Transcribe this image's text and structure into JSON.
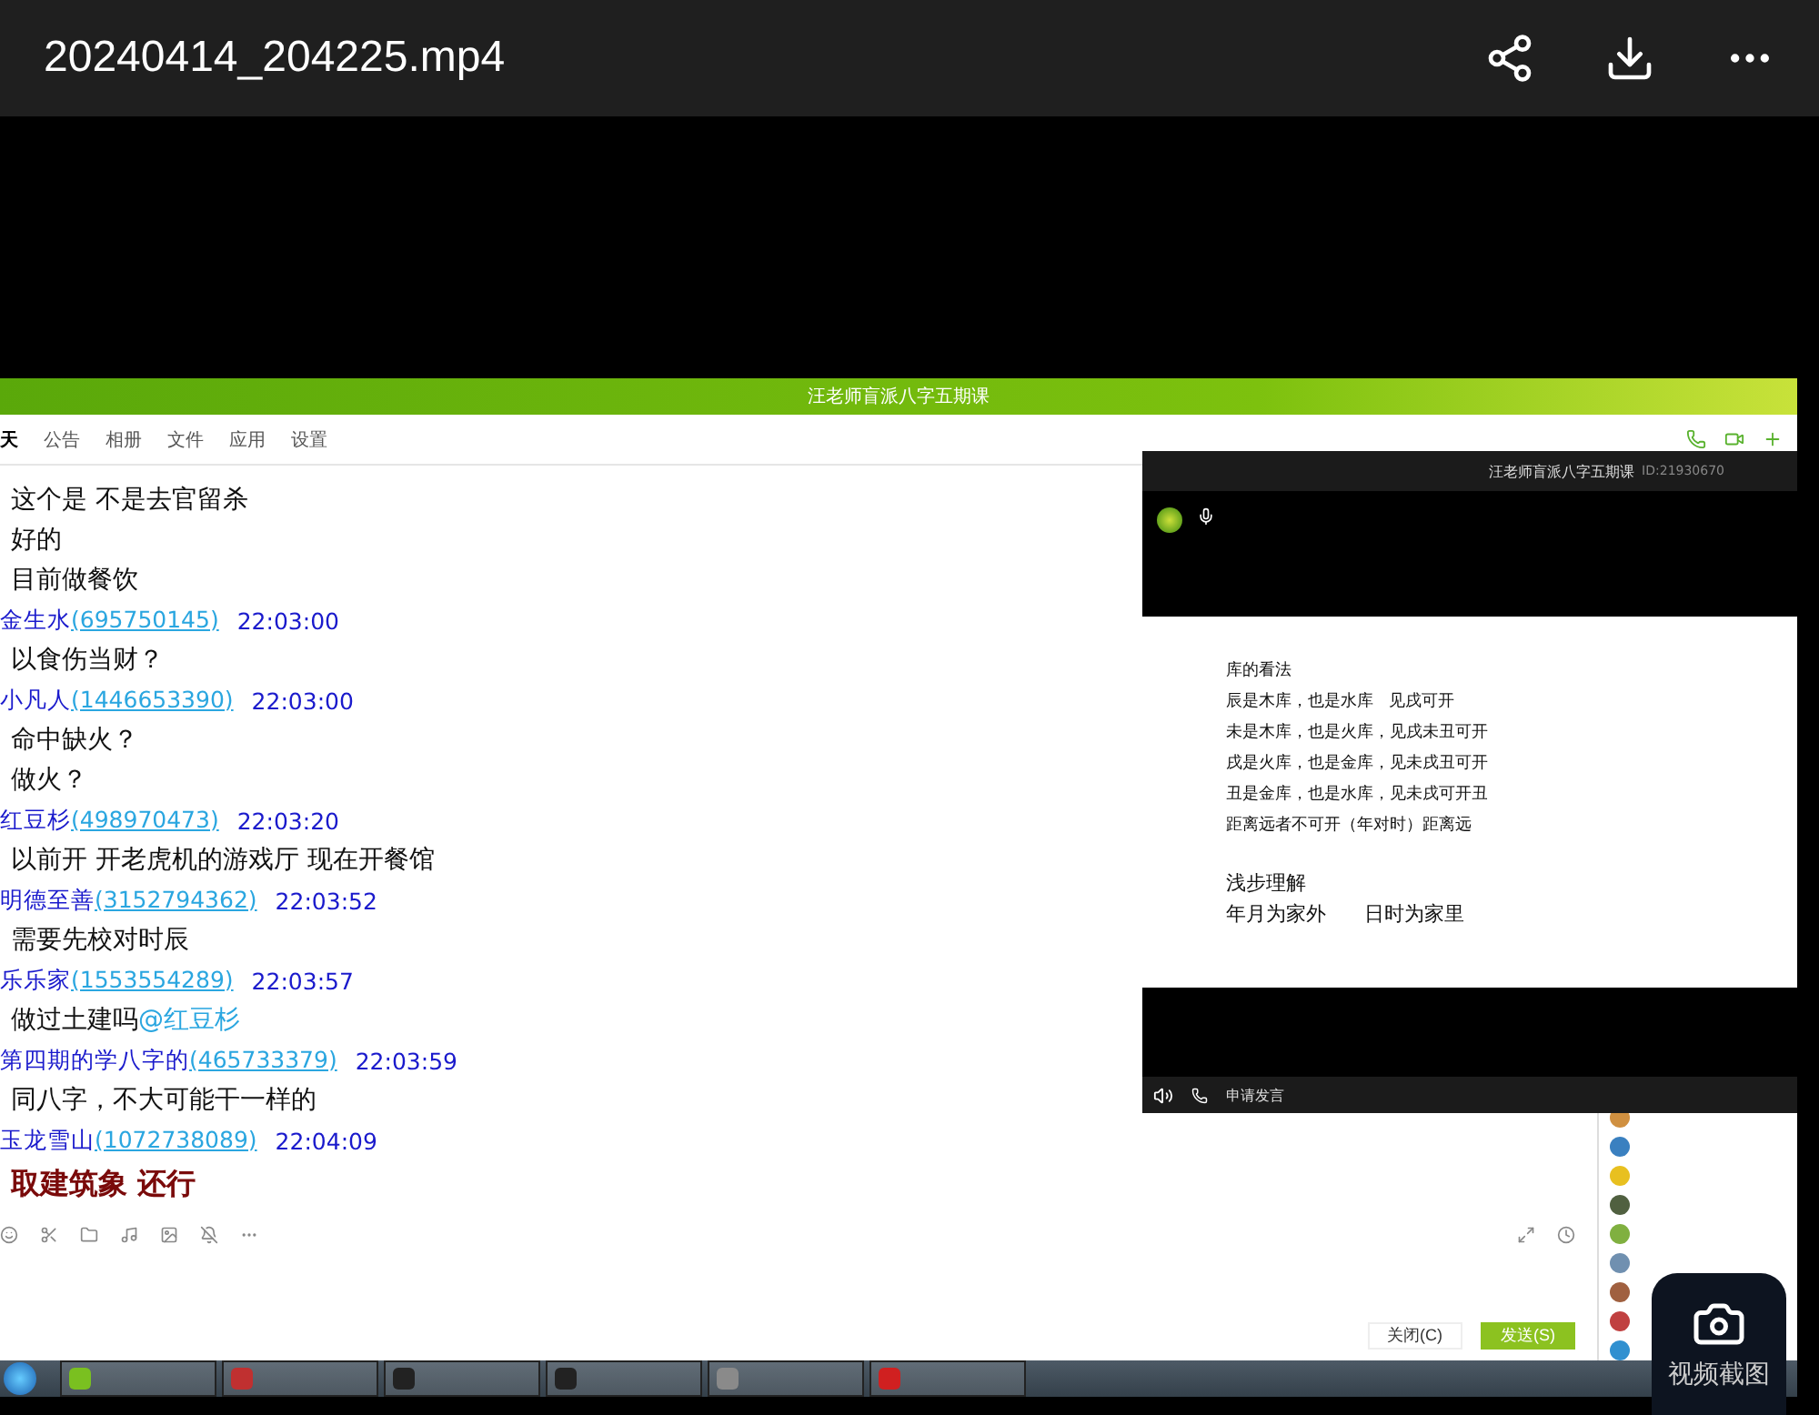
{
  "player": {
    "title": "20240414_204225.mp4",
    "screenshot_label": "视频截图"
  },
  "qq": {
    "title": "汪老师盲派八字五期课",
    "tabs": [
      {
        "label": "天",
        "selected": true
      },
      {
        "label": "公告",
        "selected": false
      },
      {
        "label": "相册",
        "selected": false
      },
      {
        "label": "文件",
        "selected": false
      },
      {
        "label": "应用",
        "selected": false
      },
      {
        "label": "设置",
        "selected": false
      }
    ],
    "messages": [
      {
        "kind": "text",
        "text": "这个是 不是去官留杀"
      },
      {
        "kind": "text",
        "text": "好的"
      },
      {
        "kind": "text",
        "text": "目前做餐饮"
      },
      {
        "kind": "header",
        "name": "金生水",
        "qq": "(695750145)",
        "time": "22:03:00"
      },
      {
        "kind": "text",
        "text": "以食伤当财？"
      },
      {
        "kind": "header",
        "name": "小凡人",
        "qq": "(1446653390)",
        "time": "22:03:00"
      },
      {
        "kind": "text",
        "text": "命中缺火？"
      },
      {
        "kind": "text",
        "text": "做火？"
      },
      {
        "kind": "header",
        "name": "红豆杉",
        "qq": "(498970473)",
        "time": "22:03:20"
      },
      {
        "kind": "text",
        "text": "以前开 开老虎机的游戏厅 现在开餐馆"
      },
      {
        "kind": "header",
        "name": "明德至善",
        "qq": "(3152794362)",
        "time": "22:03:52"
      },
      {
        "kind": "text",
        "text": "需要先校对时辰"
      },
      {
        "kind": "header",
        "name": "乐乐家",
        "qq": "(1553554289)",
        "time": "22:03:57"
      },
      {
        "kind": "text",
        "text": "做过土建吗",
        "mention": "@红豆杉"
      },
      {
        "kind": "header",
        "name": "第四期的学八字的",
        "qq": "(465733379)",
        "time": "22:03:59"
      },
      {
        "kind": "text",
        "text": "同八字，不大可能干一样的"
      },
      {
        "kind": "header",
        "name": "玉龙雪山",
        "qq": "(1072738089)",
        "time": "22:04:09"
      },
      {
        "kind": "bold",
        "text": "取建筑象 还行"
      }
    ],
    "buttons": [
      {
        "label": "关闭(C)",
        "kind": "plain"
      },
      {
        "label": "发送(S)",
        "kind": "primary"
      }
    ]
  },
  "live": {
    "title": "汪老师盲派八字五期课",
    "id": "ID:21930670",
    "apply_label": "申请发言",
    "slide": [
      {
        "kind": "line",
        "text": "库的看法"
      },
      {
        "kind": "line",
        "text": "辰是木库，也是水库   见戌可开"
      },
      {
        "kind": "line",
        "text": "未是木库，也是火库，见戌未丑可开"
      },
      {
        "kind": "line",
        "text": "戌是火库，也是金库，见未戌丑可开"
      },
      {
        "kind": "line",
        "text": "丑是金库，也是水库，见未戌可开丑"
      },
      {
        "kind": "line",
        "text": "距离远者不可开（年对时）距离远"
      },
      {
        "kind": "gap",
        "text": "浅步理解"
      },
      {
        "kind": "big",
        "text": "年月为家外      日时为家里"
      }
    ]
  }
}
